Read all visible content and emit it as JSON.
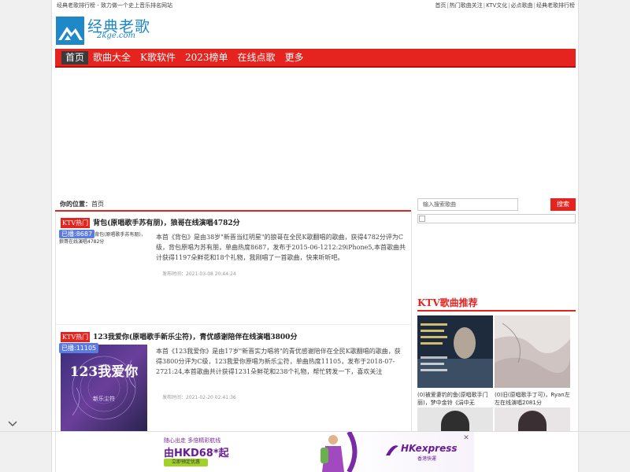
{
  "topbar": {
    "tagline": "经典老歌排行榜 - 致力做一个史上音乐排名网站",
    "links": [
      "首页",
      "热门歌曲关注",
      "KTV文化",
      "必点歌曲",
      "经典老歌排行榜"
    ]
  },
  "logo": {
    "name": "经典老歌",
    "domain": "2kge.com"
  },
  "nav": [
    "首页",
    "歌曲大全",
    "K歌软件",
    "2023榜单",
    "在线点歌",
    "更多"
  ],
  "breadcrumb": {
    "label": "你的位置：",
    "current": "首页"
  },
  "posts": [
    {
      "category": "KTV热门",
      "title": "背包(原唱歌手苏有朋)，狼哥在线演唱4782分",
      "badge": "已播:8687",
      "thumb_alt": "背包(原唱歌手苏有朋)，狼哥在线演唱4782分",
      "excerpt": "本首《背包》是由38岁\"新晋当红明星\"的狼哥在全民K歌翻唱的歌曲，获得4782分评为C级，背包原唱为苏有朋，单曲热度8687，发布于2015-06-1212:29iPhone5,本首歌曲共计获得1197朵鲜花和18个礼物，我刚唱了一首歌曲，快来听听吧。",
      "time": "发布时间：2021-03-08 20:44:24"
    },
    {
      "category": "KTV热门",
      "title": "123我爱你(原唱歌手新乐尘符)，青优感谢陪伴在线演唱3800分",
      "badge": "已播:11105",
      "thumb_text": "123我爱你",
      "thumb_sub": "新乐尘符",
      "excerpt": "本首《123我爱你》是由17岁\"新晋实力唱将\"的青优感谢陪伴在全民K歌翻唱的歌曲，获得3800分评为C级，123我爱你原唱为新乐尘符，单曲热度11105，发布于2018-07-2721:24,本首歌曲共计获得1231朵鲜花和238个礼物，帮忙转发一下，喜欢关注",
      "time": "发布时间：2021-02-20 02:41:36"
    }
  ],
  "sidebar": {
    "search_placeholder": "输入搜索歌曲",
    "search_button": "搜索",
    "section_title": "KTV歌曲推荐",
    "cards": [
      {
        "caption": "(0)被爱妻钓的鱼(原唱歌手门丽)，梦中金铃《涓中无"
      },
      {
        "caption": "(0)旧(原唱歌手丁可)，Ryan左左在线演唱2081分"
      }
    ]
  },
  "ad": {
    "line1": "随心出走 多倍精彩航线",
    "line2": "由HKD68*起",
    "cta": "立即预定优惠",
    "brand": "HKexpress",
    "brand_sub": "香港快運",
    "close": "✕"
  },
  "colors": {
    "accent": "#e52420",
    "brand_blue": "#1e88c8",
    "badge": "#5b7be0"
  }
}
